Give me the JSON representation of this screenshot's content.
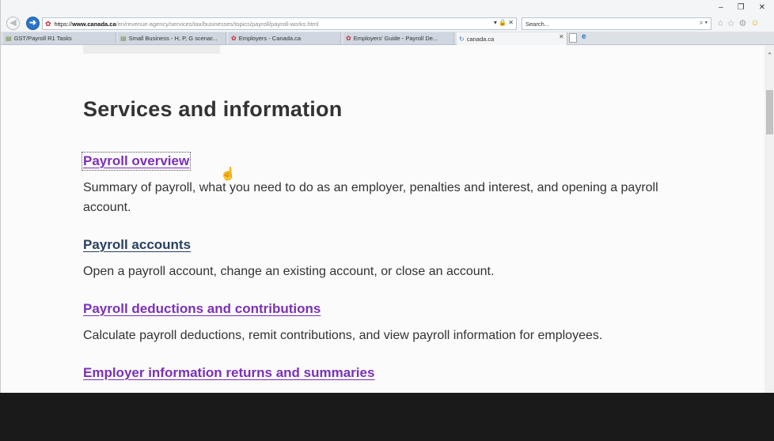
{
  "browser": {
    "address": {
      "https": "https://",
      "domain": "www.canada.ca",
      "path": "/en/revenue-agency/services/tax/businesses/topics/payroll/payroll-works.html",
      "tools": "▾ 🔒 ✕"
    },
    "search": {
      "placeholder": "Search...",
      "tools": "⌕ ▾"
    },
    "window_controls": [
      "–",
      "❐",
      "✕"
    ],
    "tabs": [
      {
        "label": "GST/Payroll R1 Tasks",
        "icon": "document-icon"
      },
      {
        "label": "Small Business - H, P, G scenar...",
        "icon": "document-icon"
      },
      {
        "label": "Employers - Canada.ca",
        "icon": "maple-leaf-icon"
      },
      {
        "label": "Employers' Guide - Payroll De...",
        "icon": "maple-leaf-icon"
      },
      {
        "label": "canada.ca",
        "icon": "loading-icon",
        "active": true
      }
    ],
    "tab_close": "✕"
  },
  "page": {
    "title": "Services and information",
    "sections": [
      {
        "link": "Payroll overview",
        "description": "Summary of payroll, what you need to do as an employer, penalties and interest, and opening a payroll account."
      },
      {
        "link": "Payroll accounts",
        "description": "Open a payroll account, change an existing account, or close an account."
      },
      {
        "link": "Payroll deductions and contributions",
        "description": "Calculate payroll deductions, remit contributions, and view payroll information for employees."
      },
      {
        "link": "Employer information returns and summaries",
        "description": ""
      }
    ]
  }
}
